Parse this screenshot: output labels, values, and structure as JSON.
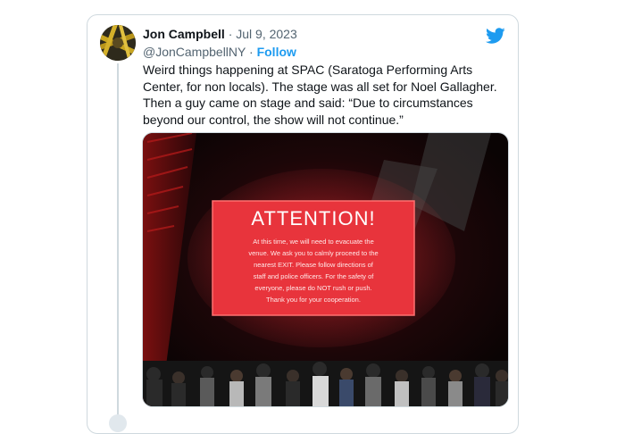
{
  "tweet": {
    "author_name": "Jon Campbell",
    "separator": "·",
    "date": "Jul 9, 2023",
    "handle": "@JonCampbellNY",
    "follow_separator": "·",
    "follow_label": "Follow",
    "text": "Weird things happening at SPAC (Saratoga Performing Arts Center, for non locals). The stage was all set for Noel Gallagher. Then a guy came on stage and said: “Due to circumstances beyond our control, the show will not continue.”"
  },
  "media": {
    "sign_title": "ATTENTION!",
    "sign_lines": [
      "At this time, we will need to evacuate the",
      "venue. We ask you to calmly proceed to the",
      "nearest EXIT. Please follow directions of",
      "staff and police officers. For the safety of",
      "everyone, please do NOT rush or push.",
      "Thank you for your cooperation."
    ]
  },
  "colors": {
    "accent": "#1d9bf0",
    "sign_red": "#e8343c",
    "text": "#0f1419",
    "muted": "#536471"
  },
  "icons": {
    "brand": "twitter-bird-icon"
  }
}
